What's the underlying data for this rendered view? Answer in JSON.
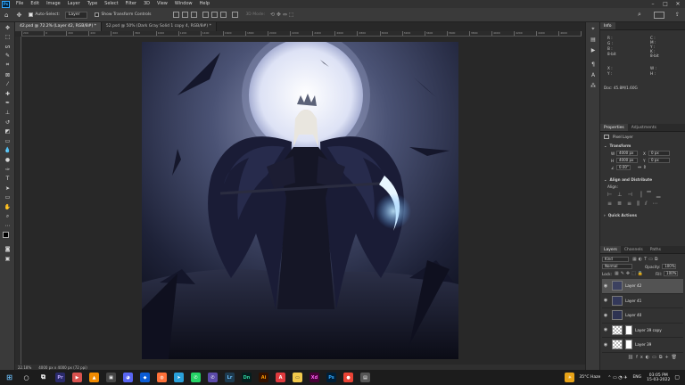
{
  "menubar": {
    "logo": "Ps",
    "items": [
      "File",
      "Edit",
      "Image",
      "Layer",
      "Type",
      "Select",
      "Filter",
      "3D",
      "View",
      "Window",
      "Help"
    ]
  },
  "options": {
    "auto_select_label": "Auto-Select:",
    "auto_select_value": "Layer",
    "transform_controls_label": "Show Transform Controls",
    "mode_3d_label": "3D Mode:"
  },
  "tabs": [
    {
      "label": "42.psd @ 72.2% (Layer 42, RGB/8#) *",
      "active": true
    },
    {
      "label": "52.psd @ 50% (Dark Gray Solid 1 copy 4, RGB/8#) *",
      "active": false
    }
  ],
  "ruler": {
    "top_ticks": [
      "200",
      "0",
      "200",
      "400",
      "600",
      "800",
      "1000",
      "1200",
      "1400",
      "1600",
      "1800",
      "2000",
      "2200",
      "2400",
      "2600",
      "2800",
      "3000",
      "3200",
      "3400",
      "3600",
      "3800",
      "4000",
      "4200",
      "4400",
      "4600",
      "4800"
    ]
  },
  "status": {
    "zoom": "22.18%",
    "doc_size": "4000 px x 4000 px (72 ppi)"
  },
  "info_panel": {
    "tab": "Info",
    "r": "R :",
    "g": "G :",
    "b": "B :",
    "c": "C :",
    "m": "M :",
    "y": "Y :",
    "k": "K :",
    "bit_left": "8-bit",
    "bit_right": "8-bit",
    "x": "X :",
    "yy": "Y :",
    "w": "W :",
    "h": "H :",
    "doc": "Doc: 45.8M/1.60G"
  },
  "properties": {
    "tabs": [
      "Properties",
      "Adjustments"
    ],
    "kind": "Pixel Layer",
    "transform_title": "Transform",
    "w_label": "W",
    "w_value": "4000 px",
    "h_label": "H",
    "h_value": "4000 px",
    "x_label": "X",
    "x_value": "0 px",
    "y_label": "Y",
    "y_value": "0 px",
    "angle_value": "0.00°",
    "align_title": "Align and Distribute",
    "align_label": "Align:",
    "quick_title": "Quick Actions"
  },
  "layers_panel": {
    "tabs": [
      "Layers",
      "Channels",
      "Paths"
    ],
    "kind_select": "Kind",
    "blend_mode": "Normal",
    "opacity_label": "Opacity:",
    "opacity_value": "100%",
    "lock_label": "Lock:",
    "fill_label": "Fill:",
    "fill_value": "100%",
    "layers": [
      {
        "name": "Layer 42",
        "selected": true
      },
      {
        "name": "Layer 41",
        "selected": false
      },
      {
        "name": "Layer 40",
        "selected": false
      },
      {
        "name": "Layer 39 copy",
        "selected": false
      },
      {
        "name": "Layer 39",
        "selected": false
      }
    ]
  },
  "taskbar": {
    "weather": "35°C Haze",
    "lang": "ENG",
    "time": "03:05 PM",
    "date": "15-03-2022"
  },
  "colors": {
    "accent": "#31a8ff",
    "panel_bg": "#323232",
    "canvas_bg": "#282828"
  }
}
